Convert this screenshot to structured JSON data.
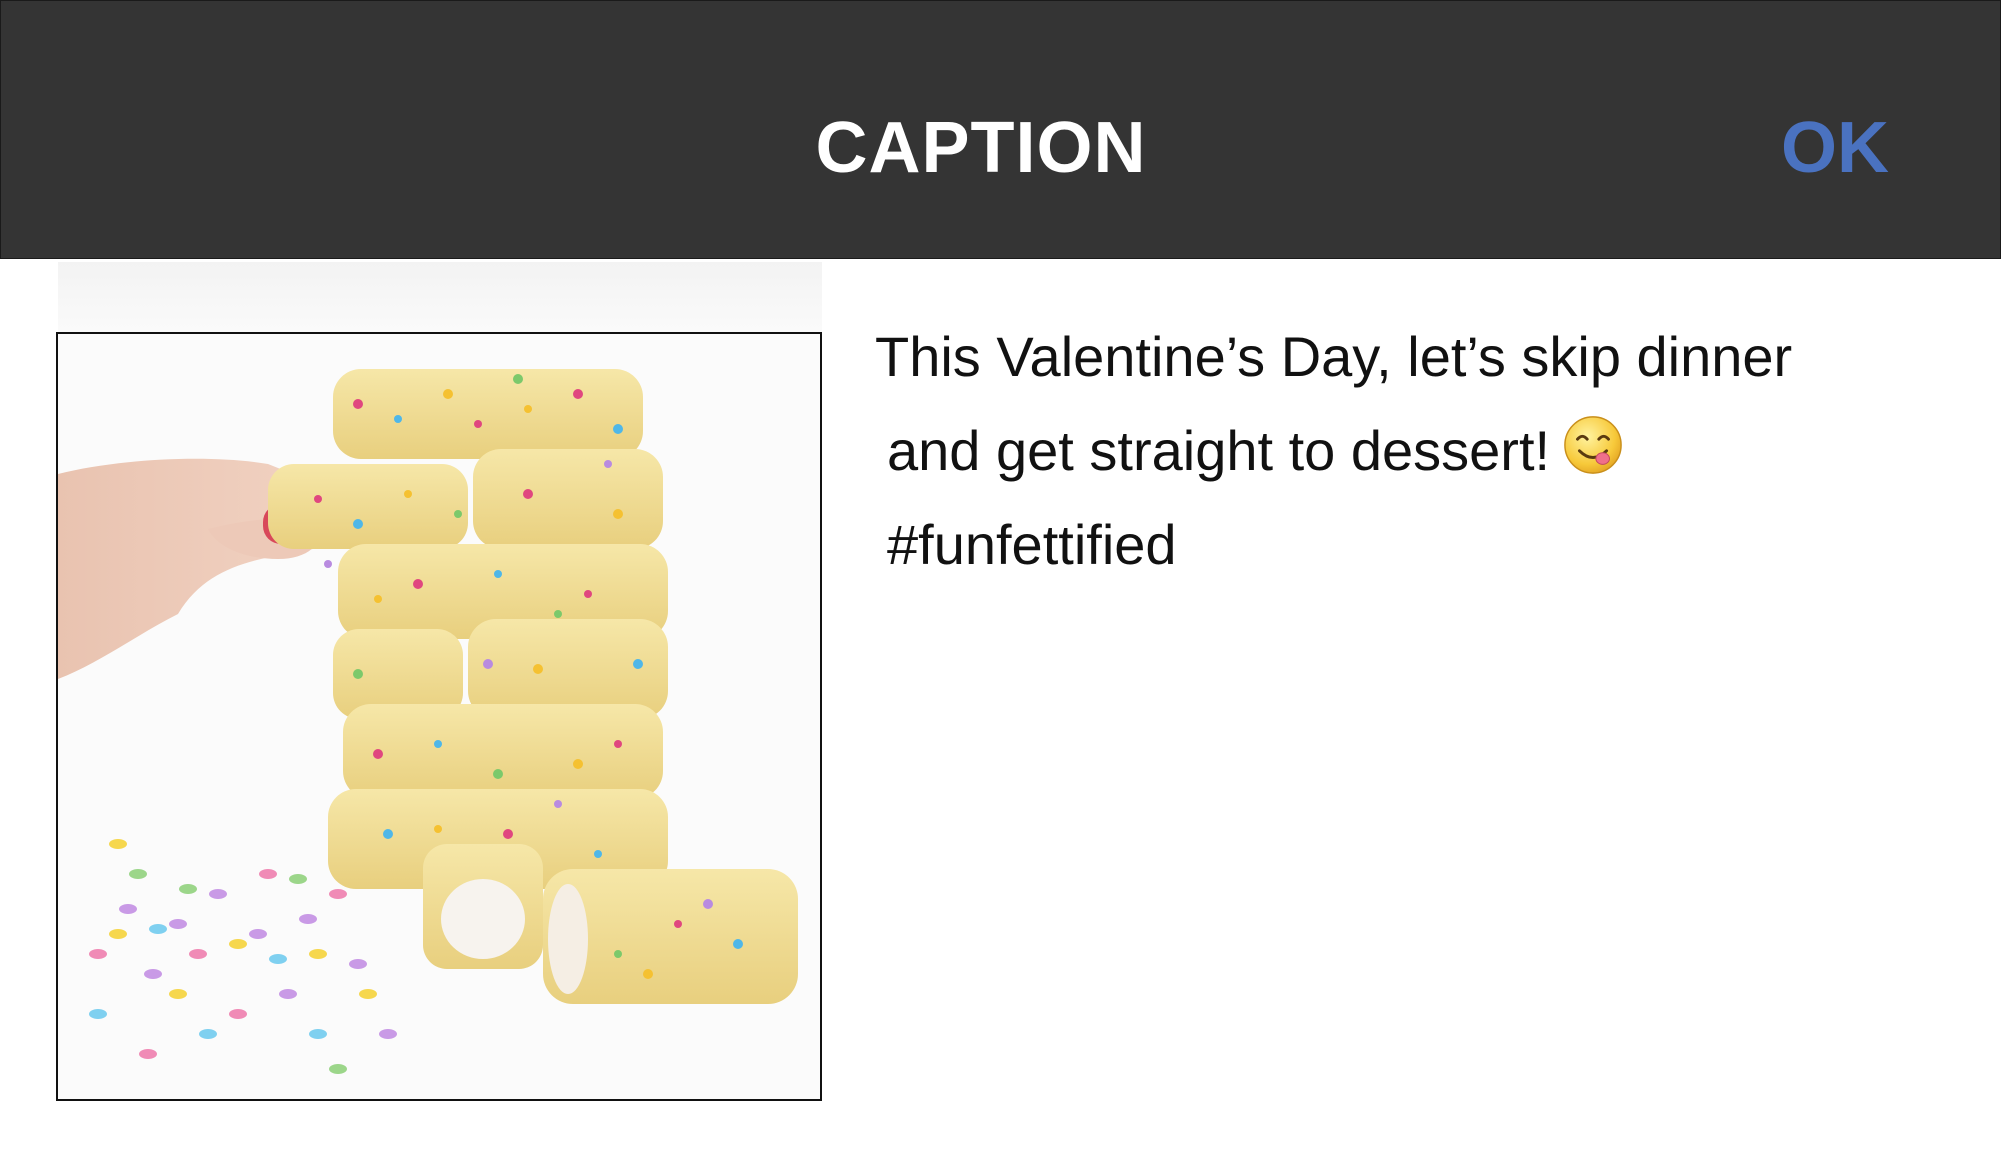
{
  "header": {
    "title": "CAPTION",
    "ok_label": "OK",
    "background": "#343434",
    "ok_color": "#4a72c0"
  },
  "photo": {
    "icon": "funfetti-twinkie-stack-photo"
  },
  "caption": {
    "line1": "This Valentine’s Day, let’s skip dinner",
    "line2": "and get straight to dessert!",
    "emoji": "face-savoring-food-emoji",
    "line3": "#funfettified"
  }
}
